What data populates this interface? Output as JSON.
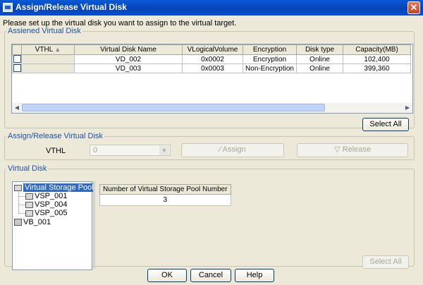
{
  "window": {
    "title": "Assign/Release Virtual Disk",
    "close_glyph": "✕"
  },
  "instruction": "Please set up the virtual disk you want to assign to the virtual target.",
  "assigned": {
    "legend": "Assiened Virtual Disk",
    "columns": [
      "",
      "VTHL",
      "Virtual Disk Name",
      "VLogicalVolume",
      "Encryption",
      "Disk type",
      "Capacity(MB)"
    ],
    "rows": [
      {
        "name": "VD_002",
        "vlv": "0x0002",
        "encryption": "Encryption",
        "disk_type": "Online",
        "capacity": "102,400"
      },
      {
        "name": "VD_003",
        "vlv": "0x0003",
        "encryption": "Non-Encryption",
        "disk_type": "Online",
        "capacity": "399,360"
      }
    ],
    "select_all": "Select All"
  },
  "assign_release": {
    "legend": "Assign/Release Virtual Disk",
    "vthl_label": "VTHL",
    "vthl_value": "0",
    "assign_label": "Assign",
    "release_label": "Release"
  },
  "virtual_disk": {
    "legend": "Virtual Disk",
    "tree": {
      "root": "Virtual Storage Pool",
      "children": [
        "VSP_001",
        "VSP_004",
        "VSP_005"
      ],
      "other": "VB_001"
    },
    "pool_table": {
      "header": "Number of Virtual Storage Pool Number",
      "value": "3"
    },
    "select_all": "Select All"
  },
  "footer": {
    "ok": "OK",
    "cancel": "Cancel",
    "help": "Help"
  }
}
